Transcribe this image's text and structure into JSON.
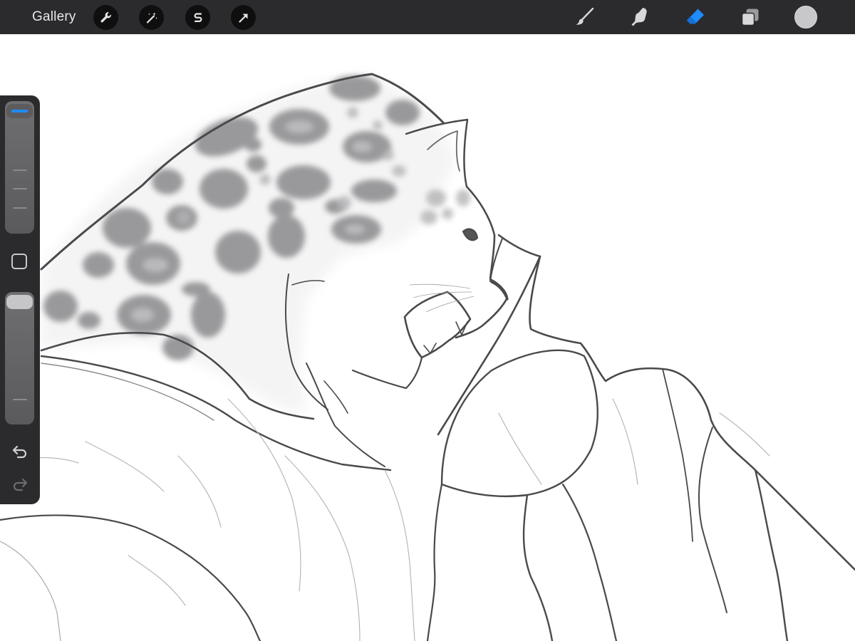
{
  "toolbar": {
    "gallery_label": "Gallery",
    "actions": [
      {
        "name": "actions-wrench-icon"
      },
      {
        "name": "adjustments-wand-icon"
      },
      {
        "name": "selection-s-icon"
      },
      {
        "name": "transform-arrow-icon"
      }
    ],
    "tools": {
      "brush": "brush-icon",
      "smudge": "smudge-finger-icon",
      "eraser": "eraser-icon",
      "layers": "layers-icon"
    },
    "active_tool": "eraser",
    "current_color": "#c8c8ca"
  },
  "sidebar": {
    "brush_size": 0.98,
    "brush_opacity": 1.0,
    "accent_color": "#1e8bff"
  },
  "colors": {
    "toolbar_bg": "#2b2b2d",
    "active_tool": "#1e8bff",
    "icon_light": "#d8d8da"
  }
}
